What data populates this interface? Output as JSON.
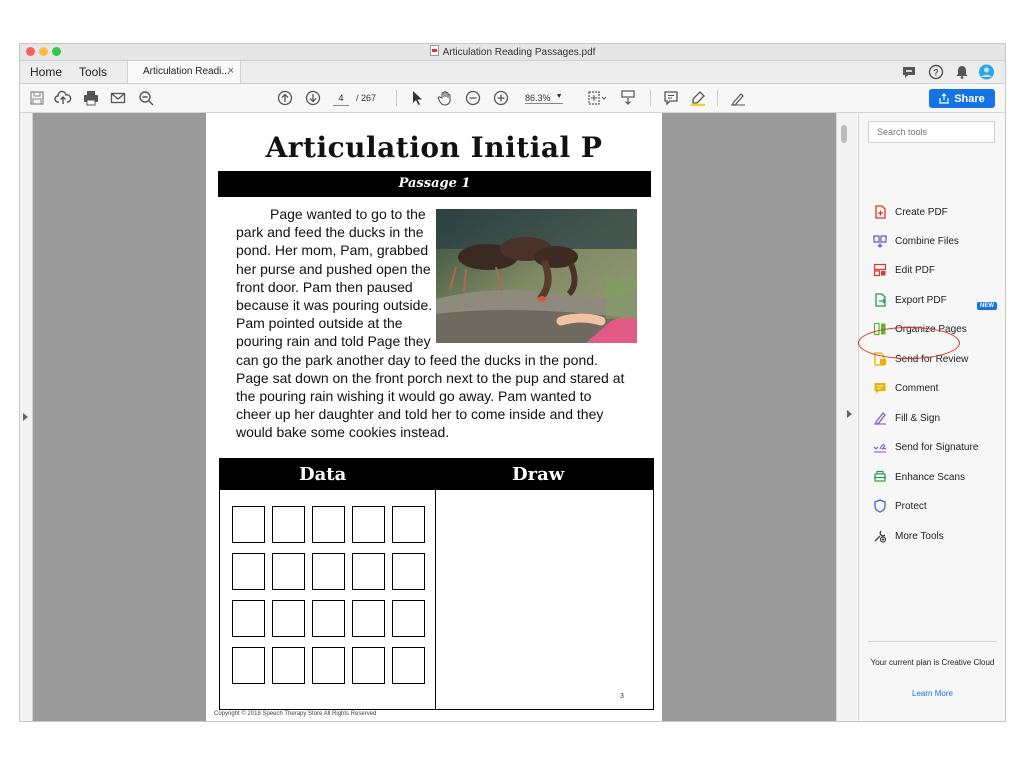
{
  "window": {
    "title": "Articulation Reading Passages.pdf",
    "traffic_lights": [
      "#fc605c",
      "#fdbc40",
      "#34c84a"
    ]
  },
  "tabs": {
    "home": "Home",
    "tools": "Tools",
    "document": "Articulation Readi...",
    "close": "×"
  },
  "toolbar": {
    "page_current": "4",
    "page_total": "/ 267",
    "zoom": "86.3%",
    "share_label": "Share",
    "accent": "#1473e6"
  },
  "page": {
    "title": "Articulation Initial P",
    "passage_label": "Passage 1",
    "story": {
      "line1": "Page wanted to go to the",
      "line2": "park and feed the ducks in the",
      "line3": "pond. Her mom, Pam, grabbed",
      "line4": "her purse and pushed open the",
      "line5": "front door. Pam then paused",
      "line6": "because it was pouring outside.",
      "line7": "Pam pointed outside at the",
      "line8": "pouring rain and told Page they",
      "line9": "can go the park another day to feed the ducks in the pond.",
      "line10": "Page sat down on the front porch next to the pup and stared at",
      "line11": "the pouring rain wishing it would go away. Pam wanted to",
      "line12": "cheer up her daughter and told her to come inside and they",
      "line13": "would bake some cookies instead."
    },
    "data_header": "Data",
    "draw_header": "Draw",
    "page_number": "3",
    "copyright": "Copyright © 2018 Speech Therapy Store All Rights Reserved"
  },
  "tools_pane": {
    "search_placeholder": "Search tools",
    "items": [
      {
        "label": "Create PDF",
        "icon": "create-pdf-icon",
        "color": "#e2342f"
      },
      {
        "label": "Combine Files",
        "icon": "combine-files-icon",
        "color": "#6a4fd8"
      },
      {
        "label": "Edit PDF",
        "icon": "edit-pdf-icon",
        "color": "#e2342f"
      },
      {
        "label": "Export PDF",
        "icon": "export-pdf-icon",
        "color": "#2b9b4b"
      },
      {
        "label": "Organize Pages",
        "icon": "organize-pages-icon",
        "color": "#5fb531"
      },
      {
        "label": "Send for Review",
        "icon": "send-for-review-icon",
        "color": "#f0b000"
      },
      {
        "label": "Comment",
        "icon": "comment-icon",
        "color": "#f0b000"
      },
      {
        "label": "Fill & Sign",
        "icon": "fill-sign-icon",
        "color": "#7a4fd0"
      },
      {
        "label": "Send for Signature",
        "icon": "send-for-signature-icon",
        "color": "#7a4fd0"
      },
      {
        "label": "Enhance Scans",
        "icon": "enhance-scans-icon",
        "color": "#2b9b4b"
      },
      {
        "label": "Protect",
        "icon": "protect-icon",
        "color": "#4d5fd8"
      },
      {
        "label": "More Tools",
        "icon": "more-tools-icon",
        "color": "#444444"
      }
    ],
    "new_badge": "NEW",
    "plan_text": "Your current plan is Creative Cloud",
    "learn_more": "Learn More"
  }
}
